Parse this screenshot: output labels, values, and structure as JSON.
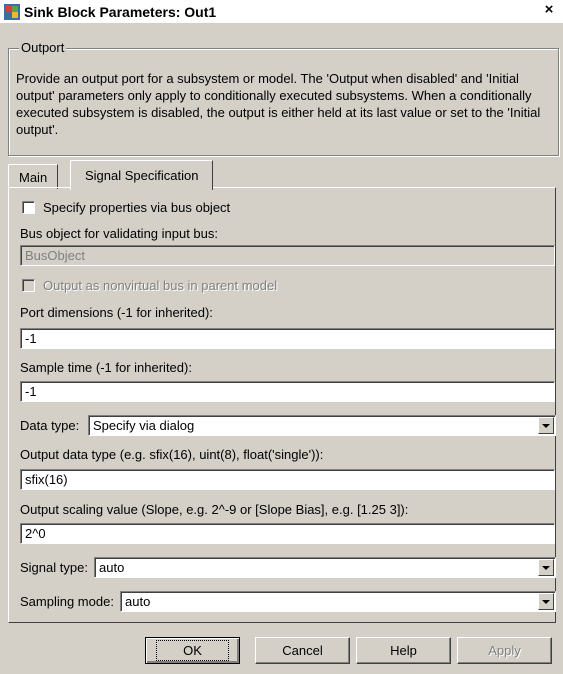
{
  "window": {
    "title": "Sink Block Parameters: Out1",
    "close_glyph": "×",
    "app_icon": "simulink-block-icon"
  },
  "group": {
    "title": "Outport",
    "description": "Provide an output port for a subsystem or model.  The 'Output when disabled' and 'Initial output' parameters only apply to conditionally executed subsystems. When a conditionally executed subsystem is disabled, the output is either held at its last value or set to the 'Initial output'."
  },
  "tabs": [
    {
      "label": "Main",
      "active": false
    },
    {
      "label": "Signal Specification",
      "active": true
    }
  ],
  "form": {
    "specify_bus_label": "Specify properties via bus object",
    "specify_bus_checked": false,
    "bus_object_label": "Bus object for validating input bus:",
    "bus_object_value": "BusObject",
    "nonvirtual_label": "Output as nonvirtual bus in parent model",
    "nonvirtual_checked": false,
    "port_dims_label": "Port dimensions (-1 for inherited):",
    "port_dims_value": "-1",
    "sample_time_label": "Sample time (-1 for inherited):",
    "sample_time_value": "-1",
    "data_type_label": "Data type:",
    "data_type_value": "Specify via dialog",
    "output_data_type_label": "Output data type (e.g. sfix(16), uint(8), float('single')):",
    "output_data_type_value": "sfix(16)",
    "output_scaling_label": "Output scaling value (Slope, e.g. 2^-9 or [Slope Bias], e.g. [1.25 3]):",
    "output_scaling_value": "2^0",
    "signal_type_label": "Signal type:",
    "signal_type_value": "auto",
    "sampling_mode_label": "Sampling mode:",
    "sampling_mode_value": "auto"
  },
  "buttons": {
    "ok": "OK",
    "cancel": "Cancel",
    "help": "Help",
    "apply": "Apply"
  },
  "colors": {
    "face": "#d4d0c8",
    "shadow": "#808080",
    "highlight": "#ffffff"
  }
}
